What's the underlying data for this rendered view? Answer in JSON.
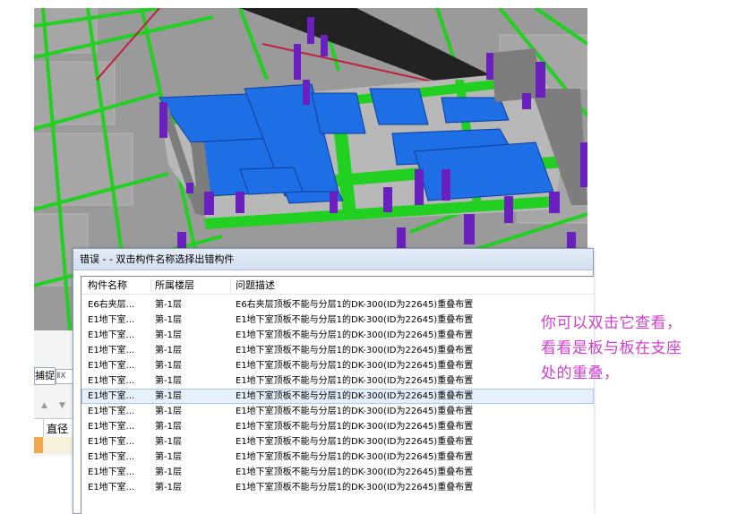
{
  "dialog": {
    "title": "错误 - - 双击构件名称选择出错构件",
    "columns": [
      "构件名称",
      "所属楼层",
      "问题描述"
    ],
    "rows": [
      {
        "name": "E6右夹层...",
        "floor": "第-1层",
        "desc": "E6右夹层顶板不能与分层1的DK-300(ID为22645)重叠布置"
      },
      {
        "name": "E1地下室...",
        "floor": "第-1层",
        "desc": "E1地下室顶板不能与分层1的DK-300(ID为22645)重叠布置"
      },
      {
        "name": "E1地下室...",
        "floor": "第-1层",
        "desc": "E1地下室顶板不能与分层1的DK-300(ID为22645)重叠布置"
      },
      {
        "name": "E1地下室...",
        "floor": "第-1层",
        "desc": "E1地下室顶板不能与分层1的DK-300(ID为22645)重叠布置"
      },
      {
        "name": "E1地下室...",
        "floor": "第-1层",
        "desc": "E1地下室顶板不能与分层1的DK-300(ID为22645)重叠布置"
      },
      {
        "name": "E1地下室...",
        "floor": "第-1层",
        "desc": "E1地下室顶板不能与分层1的DK-300(ID为22645)重叠布置"
      },
      {
        "name": "E1地下室...",
        "floor": "第-1层",
        "desc": "E1地下室顶板不能与分层1的DK-300(ID为22645)重叠布置"
      },
      {
        "name": "E1地下室...",
        "floor": "第-1层",
        "desc": "E1地下室顶板不能与分层1的DK-300(ID为22645)重叠布置"
      },
      {
        "name": "E1地下室...",
        "floor": "第-1层",
        "desc": "E1地下室顶板不能与分层1的DK-300(ID为22645)重叠布置"
      },
      {
        "name": "E1地下室...",
        "floor": "第-1层",
        "desc": "E1地下室顶板不能与分层1的DK-300(ID为22645)重叠布置"
      },
      {
        "name": "E1地下室...",
        "floor": "第-1层",
        "desc": "E1地下室顶板不能与分层1的DK-300(ID为22645)重叠布置"
      },
      {
        "name": "E1地下室...",
        "floor": "第-1层",
        "desc": "E1地下室顶板不能与分层1的DK-300(ID为22645)重叠布置"
      },
      {
        "name": "E1地下室...",
        "floor": "第-1层",
        "desc": "E1地下室顶板不能与分层1的DK-300(ID为22645)重叠布置"
      }
    ],
    "selected_row": 6
  },
  "side_panel": {
    "tab_label": "捕捉",
    "tab2_label": "ⅡX",
    "column_label": "直径"
  },
  "annotation": {
    "lines": [
      "你可以双击它查看，",
      "看看是板与板在支座",
      "处的重叠，"
    ],
    "color": "#d23fd1"
  },
  "colors": {
    "slab_blue": "#1e6fe6",
    "beam_green": "#22d022",
    "column_purple": "#6a1fbf",
    "background_gray": "#9a9a9a"
  }
}
